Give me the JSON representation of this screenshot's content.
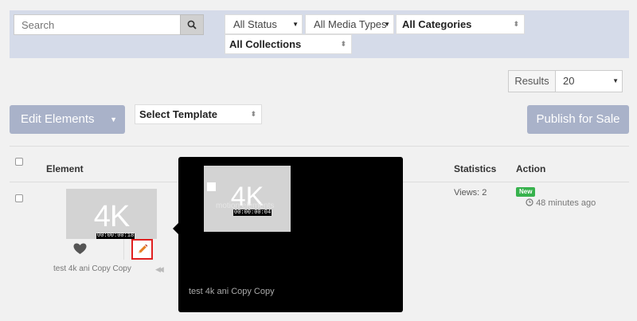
{
  "filters": {
    "search_placeholder": "Search",
    "status": "All Status",
    "media_types": "All Media Types",
    "categories": "All Categories",
    "collections": "All Collections"
  },
  "results": {
    "label": "Results",
    "value": "20"
  },
  "toolbar": {
    "edit_elements": "Edit Elements",
    "select_template": "Select Template",
    "publish": "Publish for Sale"
  },
  "table": {
    "headers": {
      "element": "Element",
      "statistics": "Statistics",
      "action": "Action"
    },
    "rows": [
      {
        "thumb_text": "4K",
        "duration": "00:00:00:18",
        "name": "test 4k ani Copy Copy",
        "stats": "Views: 2",
        "badge": "New",
        "time_ago": "48 minutes ago"
      }
    ]
  },
  "popup": {
    "thumb_text": "4K",
    "ghost_text": "motion elements",
    "duration": "00:00:00:04",
    "title": "test 4k ani Copy Copy"
  },
  "colors": {
    "filter_band": "#d5dbe9",
    "button": "#a9b2c9",
    "new_badge": "#37b24d",
    "highlight": "#e02020",
    "pencil": "#e67e22"
  },
  "icons": {
    "search": "search-icon",
    "heart": "heart-icon",
    "pencil": "pencil-icon",
    "clock": "clock-icon",
    "eye": "eye-icon"
  }
}
